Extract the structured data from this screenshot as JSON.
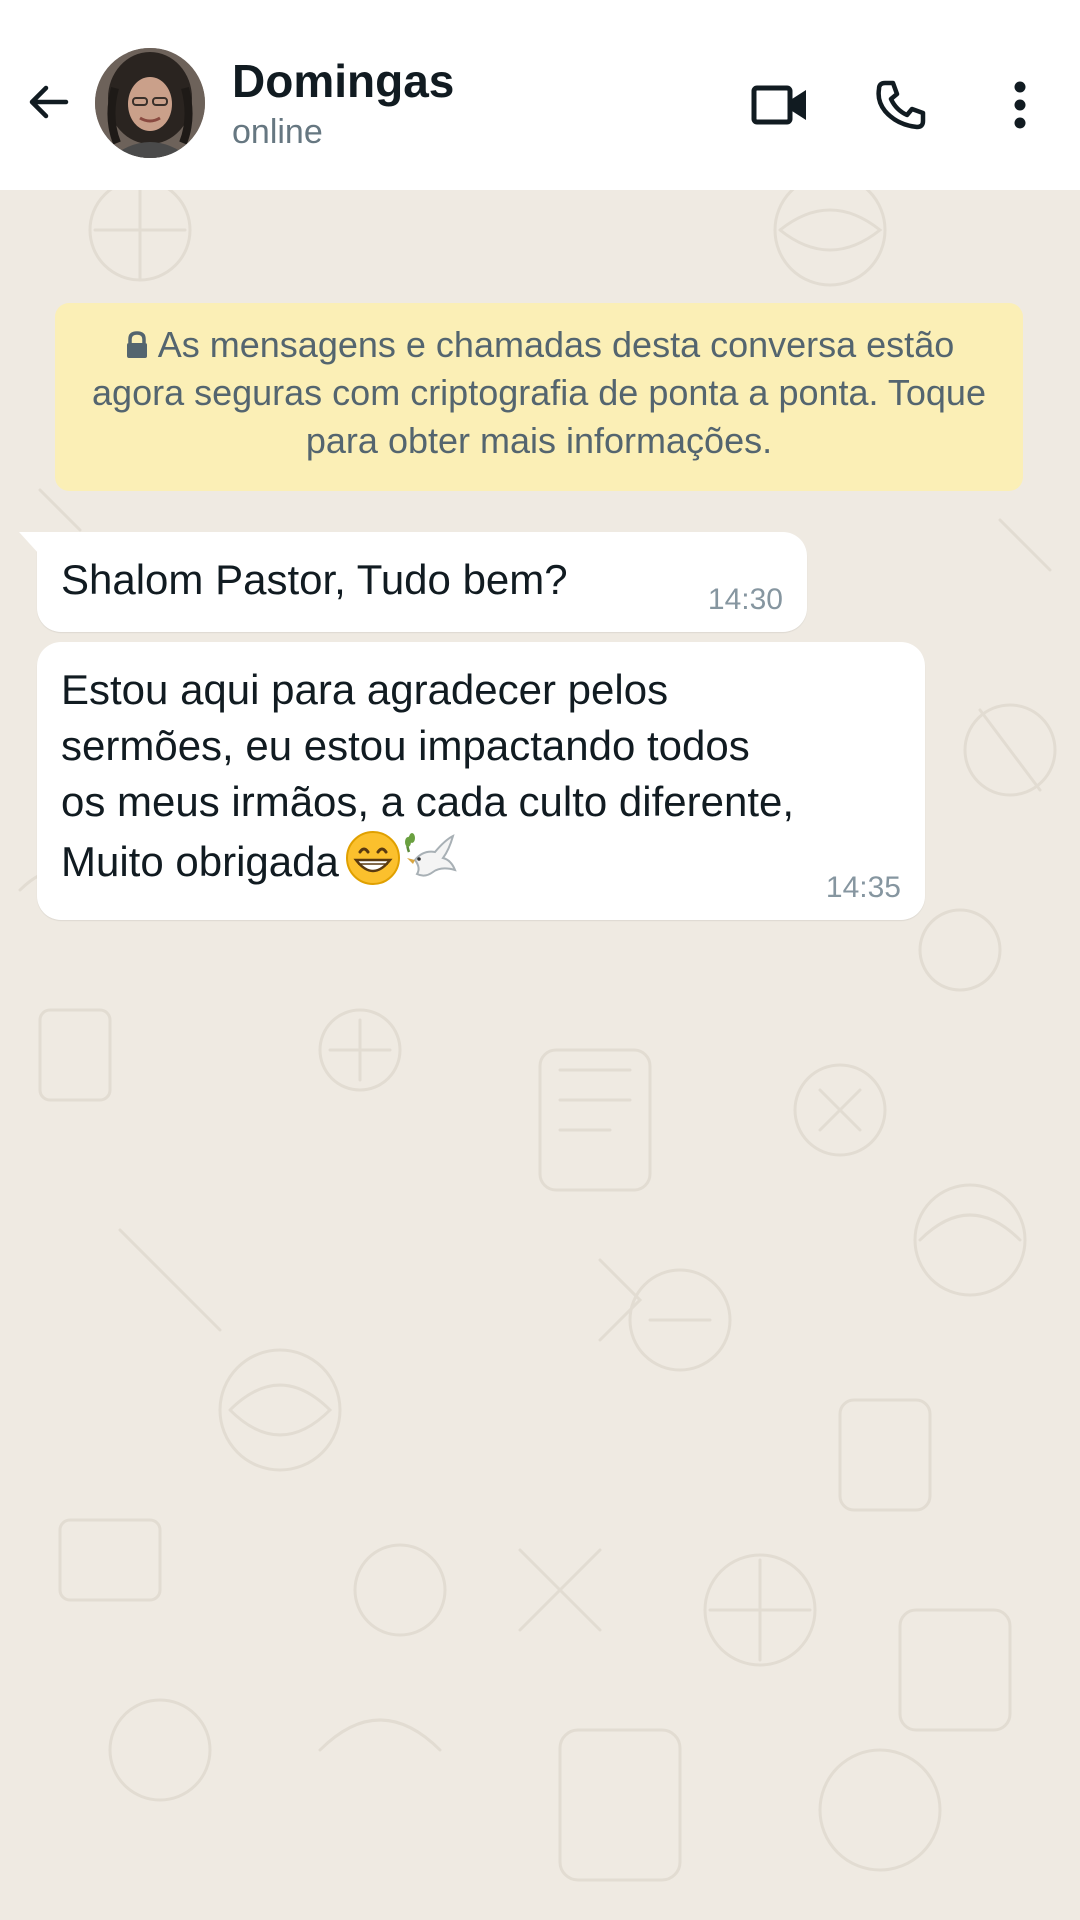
{
  "header": {
    "contact_name": "Domingas",
    "contact_status": "online",
    "icons": {
      "back": "arrow-left-icon",
      "video": "video-call-icon",
      "call": "phone-icon",
      "menu": "more-vertical-icon"
    }
  },
  "chat": {
    "encryption_notice": "As mensagens e chamadas desta conversa estão agora seguras com criptografia de ponta a ponta. Toque para obter mais informações.",
    "messages": [
      {
        "text": "Shalom Pastor, Tudo bem?",
        "time": "14:30",
        "direction": "incoming"
      },
      {
        "text": "Estou aqui para agradecer pelos\nsermões, eu estou impactando todos\nos meus irmãos, a cada culto diferente,\nMuito obrigada",
        "emojis": [
          "grinning-face",
          "dove"
        ],
        "time": "14:35",
        "direction": "incoming"
      }
    ]
  },
  "colors": {
    "chat_background": "#efeae2",
    "header_background": "#ffffff",
    "notice_background": "#fbefb6",
    "bubble_incoming": "#ffffff",
    "timestamp": "#8696a0"
  }
}
